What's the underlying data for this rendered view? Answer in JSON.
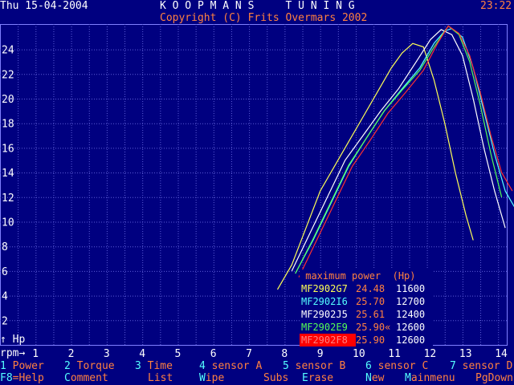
{
  "header": {
    "date": "Thu 15-04-2004",
    "title": "K O O P M A N S     T U N I N G",
    "copyright": "Copyright (C) Frits Overmars 2002",
    "time": "23:22"
  },
  "axes": {
    "y_unit": "↑ Hp",
    "x_unit": "rpm→"
  },
  "legend": {
    "header": " maximum power  (Hp)",
    "rows": [
      {
        "name": "MF2902G7",
        "value": "24.48",
        "rpm": "11600",
        "color": "#ffff55",
        "name_bg": "#000080"
      },
      {
        "name": "MF2902I6",
        "value": "25.70",
        "rpm": "12700",
        "color": "#55ffff",
        "name_bg": "#000080"
      },
      {
        "name": "MF2902J5",
        "value": "25.61",
        "rpm": "12400",
        "color": "#ffffff",
        "name_bg": "#000080"
      },
      {
        "name": "MF2902E9",
        "value": "25.90«",
        "rpm": "12600",
        "color": "#55ff55",
        "name_bg": "#000080"
      },
      {
        "name": "MF2902F8",
        "value": "25.90",
        "rpm": "12600",
        "color": "#ff3030",
        "name_bg": "#ff0000"
      }
    ]
  },
  "fkeys_row1": [
    {
      "num": "1",
      "label": "Power"
    },
    {
      "num": "2",
      "label": "Torque"
    },
    {
      "num": "3",
      "label": "Time"
    },
    {
      "num": "4",
      "label": "sensor A"
    },
    {
      "num": "5",
      "label": "sensor B"
    },
    {
      "num": "6",
      "label": "sensor C"
    },
    {
      "num": "7",
      "label": "sensor D"
    }
  ],
  "fkeys_row2": [
    {
      "hot": "F8",
      "rest": "=Help"
    },
    {
      "hot": "C",
      "rest": "omment"
    },
    {
      "hot": "",
      "rest": "List"
    },
    {
      "hot": "W",
      "rest": "ipe"
    },
    {
      "hot": "",
      "rest": "Subs"
    },
    {
      "hot": "E",
      "rest": "rase"
    },
    {
      "hot": "N",
      "rest": "ew"
    },
    {
      "hot": "M",
      "rest": "ainmenu"
    },
    {
      "hot": "",
      "rest": "PgDown"
    }
  ],
  "chart_data": {
    "type": "line",
    "xlabel": "rpm",
    "ylabel": "Hp",
    "xlim": [
      0,
      14.5
    ],
    "ylim": [
      0,
      26
    ],
    "x_ticks": [
      1,
      2,
      3,
      4,
      5,
      6,
      7,
      8,
      9,
      10,
      11,
      12,
      13,
      14
    ],
    "y_ticks": [
      2,
      4,
      6,
      8,
      10,
      12,
      14,
      16,
      18,
      20,
      22,
      24
    ],
    "grid": true,
    "series": [
      {
        "name": "MF2902G7",
        "color": "#ffff55",
        "x": [
          7.8,
          8.2,
          8.6,
          9.0,
          9.4,
          9.8,
          10.2,
          10.6,
          11.0,
          11.3,
          11.6,
          11.9,
          12.2,
          12.5,
          12.8,
          13.1,
          13.3
        ],
        "y": [
          4.5,
          6.5,
          9.5,
          12.5,
          14.5,
          16.5,
          18.5,
          20.5,
          22.5,
          23.7,
          24.48,
          24.2,
          21.5,
          18.0,
          14.0,
          10.5,
          8.5
        ]
      },
      {
        "name": "MF2902I6",
        "color": "#55ffff",
        "x": [
          8.3,
          8.8,
          9.3,
          9.8,
          10.3,
          10.8,
          11.3,
          11.8,
          12.2,
          12.5,
          12.7,
          13.0,
          13.3,
          13.6,
          13.9,
          14.2,
          14.5
        ],
        "y": [
          5.8,
          8.5,
          11.5,
          14.5,
          16.8,
          19.0,
          20.8,
          22.5,
          24.5,
          25.5,
          25.7,
          25.0,
          22.5,
          19.0,
          15.5,
          12.5,
          11.0
        ]
      },
      {
        "name": "MF2902J5",
        "color": "#ffffff",
        "x": [
          8.2,
          8.7,
          9.2,
          9.7,
          10.2,
          10.7,
          11.2,
          11.7,
          12.1,
          12.4,
          12.7,
          13.0,
          13.3,
          13.6,
          13.9,
          14.2
        ],
        "y": [
          6.0,
          9.0,
          12.0,
          15.0,
          17.0,
          19.0,
          20.8,
          23.0,
          24.8,
          25.61,
          25.2,
          23.5,
          20.0,
          16.0,
          12.5,
          9.5
        ]
      },
      {
        "name": "MF2902E9",
        "color": "#55ff55",
        "x": [
          8.3,
          8.8,
          9.3,
          9.8,
          10.3,
          10.8,
          11.3,
          11.8,
          12.2,
          12.6,
          12.9,
          13.2,
          13.5,
          13.8,
          14.1
        ],
        "y": [
          5.8,
          8.6,
          11.6,
          14.6,
          16.8,
          19.0,
          20.7,
          22.3,
          24.2,
          25.9,
          25.2,
          23.0,
          19.5,
          15.5,
          12.0
        ]
      },
      {
        "name": "MF2902F8",
        "color": "#ff3030",
        "x": [
          8.4,
          8.9,
          9.4,
          9.9,
          10.4,
          10.9,
          11.4,
          11.9,
          12.3,
          12.6,
          12.9,
          13.2,
          13.5,
          13.8,
          14.1,
          14.4
        ],
        "y": [
          5.5,
          8.5,
          11.5,
          14.5,
          16.6,
          18.8,
          20.5,
          22.3,
          24.5,
          25.9,
          25.3,
          23.5,
          20.5,
          17.0,
          14.0,
          12.5
        ]
      }
    ]
  }
}
